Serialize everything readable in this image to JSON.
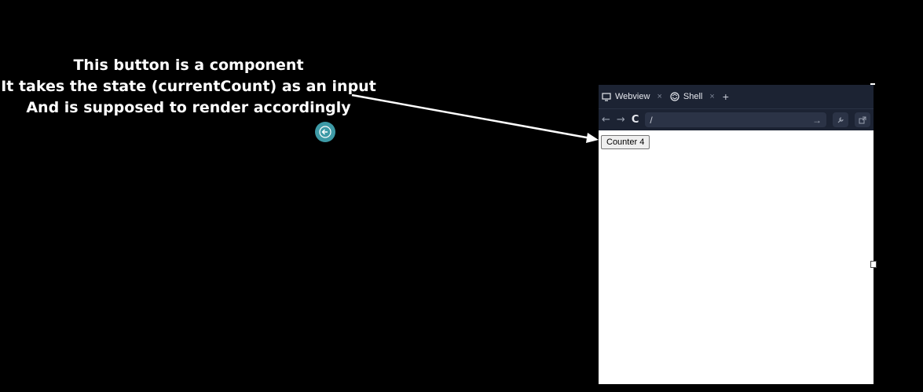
{
  "annotation": {
    "lines": [
      "This button is a component",
      "It takes the state (currentCount) as an input",
      "And is supposed to render accordingly"
    ]
  },
  "browser": {
    "tabs": [
      {
        "label": "Webview",
        "icon": "monitor-icon"
      },
      {
        "label": "Shell",
        "icon": "shell-icon"
      }
    ],
    "close_glyph": "×",
    "new_tab_glyph": "+",
    "url": "/",
    "nav": {
      "back": "←",
      "forward": "→",
      "reload": "C",
      "go": "→"
    }
  },
  "page": {
    "counter_label": "Counter 4"
  },
  "colors": {
    "background": "#000000",
    "browser_chrome": "#1c2333",
    "cursor_badge": "#3d9aa6"
  }
}
